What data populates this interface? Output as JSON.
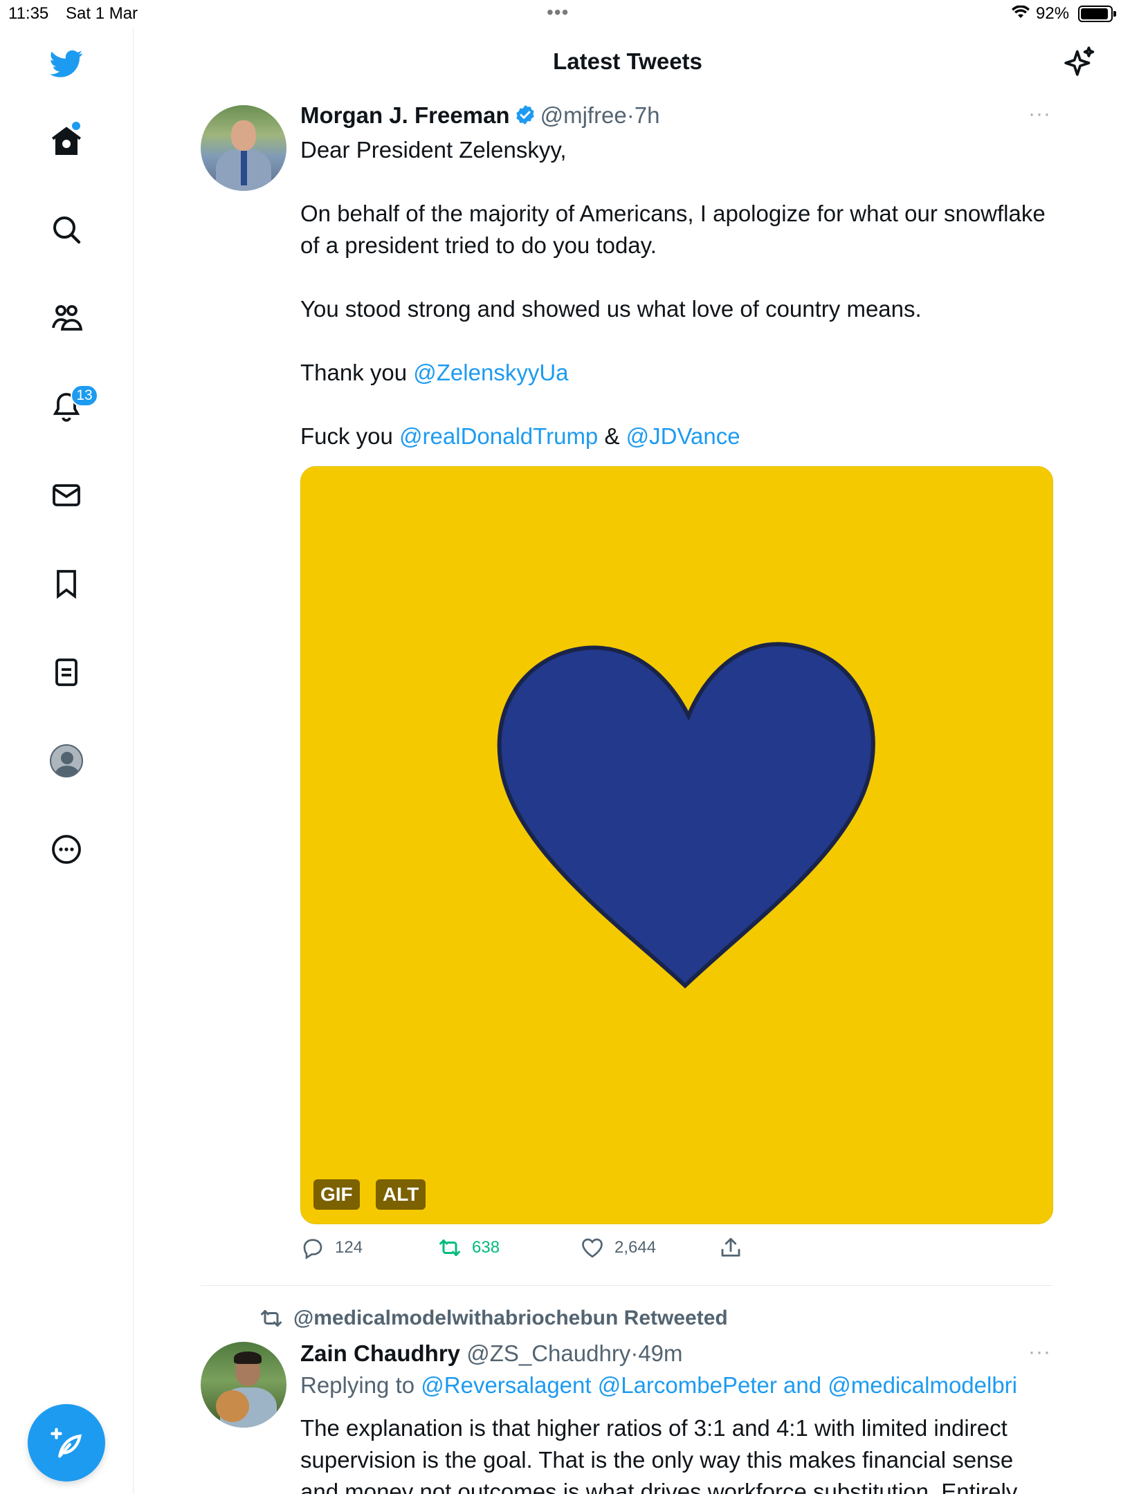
{
  "status_bar": {
    "time": "11:35",
    "date": "Sat 1 Mar",
    "battery": "92%"
  },
  "header": {
    "title": "Latest Tweets"
  },
  "sidebar": {
    "notification_count": "13"
  },
  "tweets": [
    {
      "name": "Morgan J. Freeman",
      "handle": "@mjfree",
      "separator": "·",
      "time": "7h",
      "more": "···",
      "body": {
        "greeting": "Dear President Zelenskyy,",
        "p1": "On behalf of the majority of Americans, I apologize for what our snowflake of a president tried to do you today.",
        "p2": "You stood strong and showed us what love of country means.",
        "p3_text": "Thank you ",
        "p3_mention": "@ZelenskyyUa",
        "p4_text": "Fuck you ",
        "p4_mention1": "@realDonaldTrump",
        "p4_amp": " & ",
        "p4_mention2": "@JDVance"
      },
      "media": {
        "tag1": "GIF",
        "tag2": "ALT",
        "bg_color": "#f5c900",
        "heart_color": "#22398c"
      },
      "actions": {
        "replies": "124",
        "retweets": "638",
        "likes": "2,644"
      }
    },
    {
      "retweeted_by": "@medicalmodelwithabriochebun Retweeted",
      "name": "Zain Chaudhry",
      "handle": "@ZS_Chaudhry",
      "separator": "·",
      "time": "49m",
      "more": "···",
      "replying_to_label": "Replying to ",
      "replying_to": "@Reversalagent @LarcombePeter and @medicalmodelbri",
      "body": "The explanation is that higher ratios of 3:1 and 4:1 with limited indirect supervision is the goal. That is the only way this makes financial sense and money not outcomes is what drives workforce substitution. Entirely"
    }
  ],
  "colors": {
    "accent": "#1d9bf0",
    "retweet_green": "#00ba7c",
    "text": "#0f1419",
    "secondary": "#536471"
  }
}
